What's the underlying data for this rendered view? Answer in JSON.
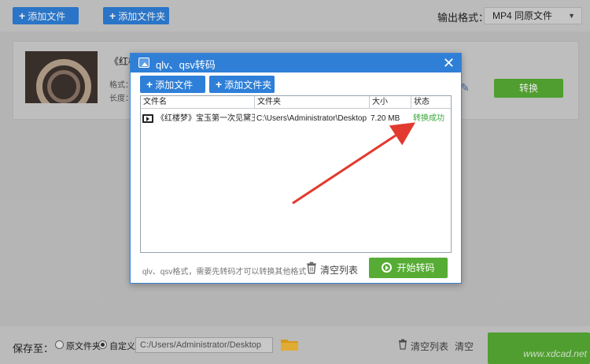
{
  "toolbar": {
    "add_file": "添加文件",
    "add_folder": "添加文件夹",
    "format_label": "输出格式：",
    "format_value": "MP4  同原文件"
  },
  "card": {
    "title": "《红楼",
    "meta_format": "格式：",
    "meta_length": "长度：",
    "convert": "转换"
  },
  "bottom": {
    "save_label": "保存至：",
    "radio_source": "原文件夹",
    "radio_custom": "自定义",
    "path": "C:/Users/Administrator/Desktop",
    "clear_list": "清空列表",
    "clear_partial": "清空",
    "watermark": "www.xdcad.net"
  },
  "dialog": {
    "title": "qlv、qsv转码",
    "add_file": "添加文件",
    "add_folder": "添加文件夹",
    "columns": [
      "文件名",
      "文件夹",
      "大小",
      "状态"
    ],
    "rows": [
      {
        "name": "《红楼梦》宝玉第一次见黛玉和",
        "folder": "C:\\Users\\Administrator\\Desktop",
        "size": "7.20 MB",
        "status": "转换成功"
      }
    ],
    "hint": "qlv、qsv格式，需要先转码才可以转换其他格式",
    "clear_list": "清空列表",
    "start": "开始转码"
  },
  "colors": {
    "accent_blue": "#2f7fd6",
    "green": "#56ac34",
    "success": "#3aa63a",
    "annotation_red": "#e23a2e"
  }
}
